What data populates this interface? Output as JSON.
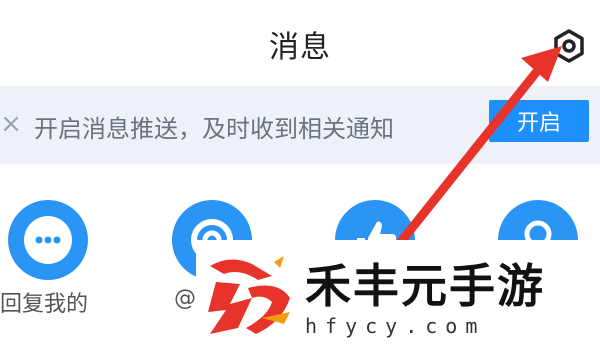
{
  "header": {
    "title": "消息",
    "settings_icon": "gear-icon"
  },
  "banner": {
    "close_icon": "close-icon",
    "text": "开启消息推送，及时收到相关通知",
    "button_label": "开启"
  },
  "categories": [
    {
      "icon": "more-dots-icon",
      "label": "回复我的"
    },
    {
      "icon": "at-icon",
      "label": "@"
    },
    {
      "icon": "thumb-up-icon",
      "label": ""
    },
    {
      "icon": "person-icon",
      "label": ""
    }
  ],
  "watermark": {
    "title": "禾丰元手游",
    "url": "hfycy.com"
  },
  "colors": {
    "accent": "#1e8fff",
    "icon_bg": "#2a95f5",
    "banner_bg": "#eef2f8",
    "arrow": "#e8332a"
  }
}
